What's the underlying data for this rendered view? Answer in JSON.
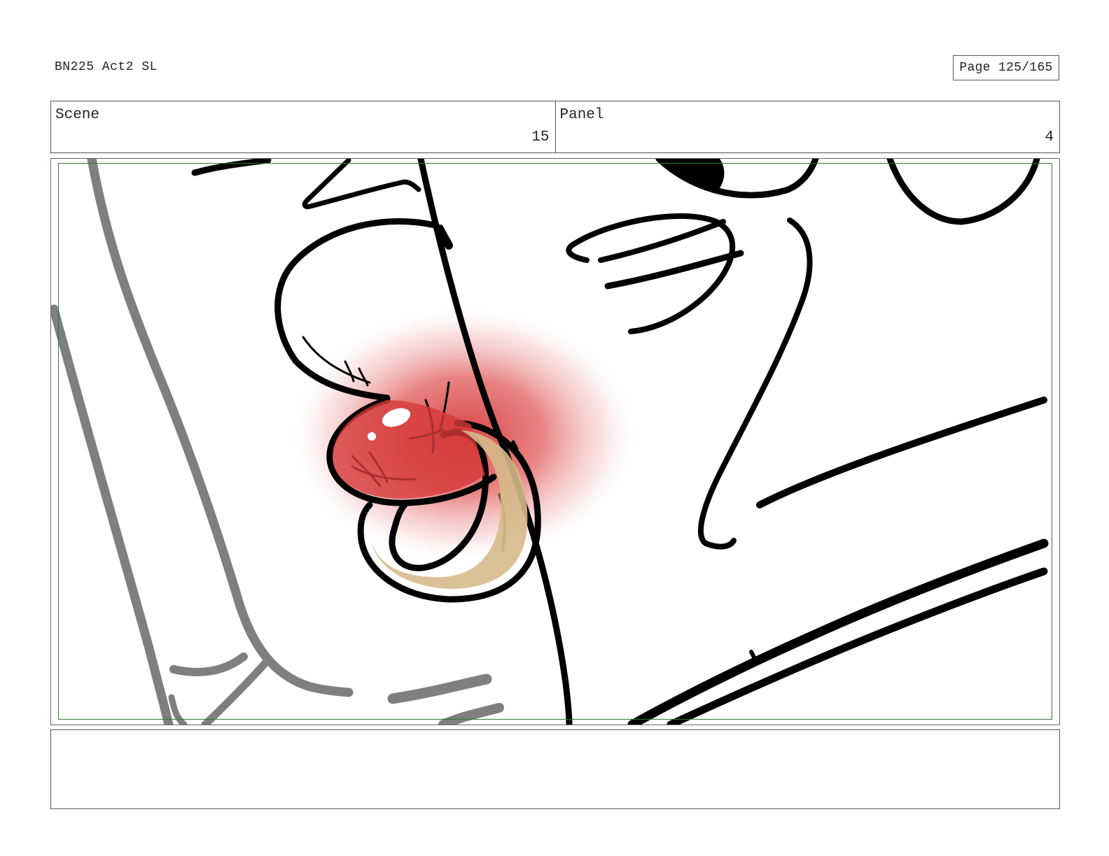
{
  "header": {
    "title": "BN225 Act2 SL",
    "page": "Page 125/165"
  },
  "panel_info": {
    "scene_label": "Scene",
    "scene_value": "15",
    "panel_label": "Panel",
    "panel_value": "4"
  },
  "artwork": {
    "description_icon": "storyboard-drawing",
    "colors": {
      "ink": "#000000",
      "gray_ink": "#7f7f7f",
      "blush": "#d63a3a",
      "gold": "#d6b98a",
      "gold_dark": "#7a5a25",
      "safe_frame": "#2f7a2f"
    }
  },
  "notes": {
    "text": ""
  }
}
